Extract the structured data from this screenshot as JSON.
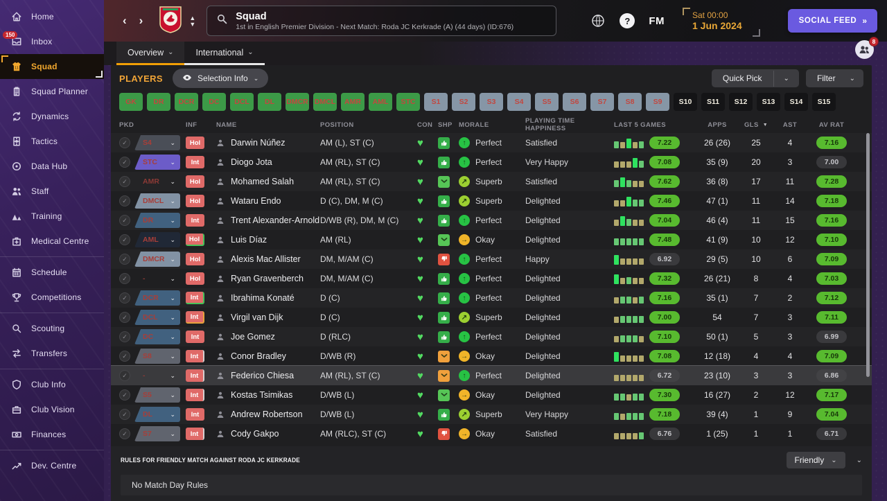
{
  "sidebar": {
    "items": [
      {
        "label": "Home",
        "icon": "home-icon"
      },
      {
        "label": "Inbox",
        "icon": "inbox-icon",
        "badge": "150"
      },
      {
        "label": "Squad",
        "icon": "jersey-icon",
        "active": true
      },
      {
        "label": "Squad Planner",
        "icon": "clipboard-icon"
      },
      {
        "label": "Dynamics",
        "icon": "dynamics-icon"
      },
      {
        "label": "Tactics",
        "icon": "tactics-icon"
      },
      {
        "label": "Data Hub",
        "icon": "data-hub-icon"
      },
      {
        "label": "Staff",
        "icon": "staff-icon"
      },
      {
        "label": "Training",
        "icon": "training-icon"
      },
      {
        "label": "Medical Centre",
        "icon": "medical-icon",
        "divider_after": true
      },
      {
        "label": "Schedule",
        "icon": "calendar-icon"
      },
      {
        "label": "Competitions",
        "icon": "trophy-icon",
        "divider_after": true
      },
      {
        "label": "Scouting",
        "icon": "scouting-icon"
      },
      {
        "label": "Transfers",
        "icon": "transfers-icon",
        "divider_after": true
      },
      {
        "label": "Club Info",
        "icon": "shield-icon"
      },
      {
        "label": "Club Vision",
        "icon": "briefcase-icon"
      },
      {
        "label": "Finances",
        "icon": "finances-icon",
        "divider_after": true
      },
      {
        "label": "Dev. Centre",
        "icon": "dev-centre-icon"
      }
    ]
  },
  "header": {
    "title": "Squad",
    "subtitle": "1st in English Premier Division - Next Match: Roda JC Kerkrade (A) (44 days) (ID:676)",
    "fm_logo": "FM",
    "help_label": "?",
    "date_line1": "Sat 00:00",
    "date_line2": "1 Jun 2024",
    "social_feed_label": "SOCIAL FEED",
    "social_feed_chevrons": "»",
    "notification_count": "8",
    "tabs": [
      {
        "label": "Overview",
        "active": true
      },
      {
        "label": "International",
        "active": false
      }
    ]
  },
  "toolbar": {
    "players_label": "PLAYERS",
    "selection_info_label": "Selection Info",
    "quick_pick_label": "Quick Pick",
    "filter_label": "Filter"
  },
  "position_filters": [
    {
      "label": "GK",
      "style": "green"
    },
    {
      "label": "DR",
      "style": "green"
    },
    {
      "label": "DCR",
      "style": "green"
    },
    {
      "label": "DC",
      "style": "green"
    },
    {
      "label": "DCL",
      "style": "green"
    },
    {
      "label": "DL",
      "style": "green"
    },
    {
      "label": "DMCR",
      "style": "green"
    },
    {
      "label": "DMCL",
      "style": "green"
    },
    {
      "label": "AMR",
      "style": "green"
    },
    {
      "label": "AML",
      "style": "green"
    },
    {
      "label": "STC",
      "style": "green"
    },
    {
      "label": "S1",
      "style": "slate"
    },
    {
      "label": "S2",
      "style": "slate"
    },
    {
      "label": "S3",
      "style": "slate"
    },
    {
      "label": "S4",
      "style": "slate"
    },
    {
      "label": "S5",
      "style": "slate"
    },
    {
      "label": "S6",
      "style": "slate"
    },
    {
      "label": "S7",
      "style": "slate"
    },
    {
      "label": "S8",
      "style": "slate"
    },
    {
      "label": "S9",
      "style": "slate"
    },
    {
      "label": "S10",
      "style": "dark"
    },
    {
      "label": "S11",
      "style": "dark"
    },
    {
      "label": "S12",
      "style": "dark"
    },
    {
      "label": "S13",
      "style": "dark"
    },
    {
      "label": "S14",
      "style": "dark"
    },
    {
      "label": "S15",
      "style": "dark"
    }
  ],
  "table": {
    "headers": {
      "pkd": "PKD",
      "inf": "INF",
      "name": "NAME",
      "position": "POSITION",
      "con": "CON",
      "shp": "SHP",
      "morale": "MORALE",
      "happiness": "PLAYING TIME HAPPINESS",
      "last5": "LAST 5 GAMES",
      "apps": "APPS",
      "gls": "GLS",
      "ast": "AST",
      "avrat": "AV RAT"
    },
    "rows": [
      {
        "pkd": "S4",
        "pkd_style": "dark",
        "inf": "Hol",
        "inf_accent": null,
        "name": "Darwin Núñez",
        "position": "AM (L), ST (C)",
        "shp": "up",
        "morale": "Perfect",
        "morale_level": "perfect",
        "happiness": "Satisfied",
        "bars": [
          "g",
          "t",
          "G",
          "t",
          "g"
        ],
        "l5": "7.22",
        "l5_pill": true,
        "apps": "26 (26)",
        "gls": "25",
        "ast": "4",
        "av": "7.16",
        "av_pill": true,
        "selected": false
      },
      {
        "pkd": "STC",
        "pkd_style": "purple",
        "inf": "Int",
        "inf_accent": null,
        "name": "Diogo Jota",
        "position": "AM (RL), ST (C)",
        "shp": "up",
        "morale": "Perfect",
        "morale_level": "perfect",
        "happiness": "Very Happy",
        "bars": [
          "t",
          "t",
          "t",
          "G",
          "g"
        ],
        "l5": "7.08",
        "l5_pill": true,
        "apps": "35 (9)",
        "gls": "20",
        "ast": "3",
        "av": "7.00",
        "av_pill": false,
        "selected": false
      },
      {
        "pkd": "AMR",
        "pkd_style": "none",
        "inf": "Hol",
        "inf_accent": null,
        "name": "Mohamed Salah",
        "position": "AM (RL), ST (C)",
        "shp": "env-green",
        "morale": "Superb",
        "morale_level": "superb",
        "happiness": "Satisfied",
        "bars": [
          "g",
          "G",
          "g",
          "t",
          "t"
        ],
        "l5": "7.62",
        "l5_pill": true,
        "apps": "36 (8)",
        "gls": "17",
        "ast": "11",
        "av": "7.28",
        "av_pill": true,
        "selected": false
      },
      {
        "pkd": "DMCL",
        "pkd_style": "slate",
        "inf": "Hol",
        "inf_accent": null,
        "name": "Wataru Endo",
        "position": "D (C), DM, M (C)",
        "shp": "up",
        "morale": "Superb",
        "morale_level": "superb",
        "happiness": "Delighted",
        "bars": [
          "t",
          "t",
          "G",
          "g",
          "g"
        ],
        "l5": "7.46",
        "l5_pill": true,
        "apps": "47 (1)",
        "gls": "11",
        "ast": "14",
        "av": "7.18",
        "av_pill": true,
        "selected": false
      },
      {
        "pkd": "DR",
        "pkd_style": "blue",
        "inf": "Int",
        "inf_accent": null,
        "name": "Trent Alexander-Arnold",
        "position": "D/WB (R), DM, M (C)",
        "shp": "up",
        "morale": "Perfect",
        "morale_level": "perfect",
        "happiness": "Delighted",
        "bars": [
          "t",
          "G",
          "g",
          "t",
          "t"
        ],
        "l5": "7.04",
        "l5_pill": true,
        "apps": "46 (4)",
        "gls": "11",
        "ast": "15",
        "av": "7.16",
        "av_pill": true,
        "selected": false
      },
      {
        "pkd": "AML",
        "pkd_style": "navy",
        "inf": "Hol",
        "inf_accent": "green",
        "name": "Luis Díaz",
        "position": "AM (RL)",
        "shp": "env-green",
        "morale": "Okay",
        "morale_level": "okay",
        "happiness": "Delighted",
        "bars": [
          "g",
          "g",
          "g",
          "g",
          "g"
        ],
        "l5": "7.48",
        "l5_pill": true,
        "apps": "41 (9)",
        "gls": "10",
        "ast": "12",
        "av": "7.10",
        "av_pill": true,
        "selected": false
      },
      {
        "pkd": "DMCR",
        "pkd_style": "slate",
        "inf": "Hol",
        "inf_accent": null,
        "name": "Alexis Mac Allister",
        "position": "DM, M/AM (C)",
        "shp": "down",
        "morale": "Perfect",
        "morale_level": "perfect",
        "happiness": "Happy",
        "bars": [
          "G",
          "t",
          "t",
          "t",
          "t"
        ],
        "l5": "6.92",
        "l5_pill": false,
        "apps": "29 (5)",
        "gls": "10",
        "ast": "6",
        "av": "7.09",
        "av_pill": true,
        "selected": false
      },
      {
        "pkd": "-",
        "pkd_style": "none",
        "inf": "Hol",
        "inf_accent": null,
        "name": "Ryan Gravenberch",
        "position": "DM, M/AM (C)",
        "shp": "up",
        "morale": "Perfect",
        "morale_level": "perfect",
        "happiness": "Delighted",
        "bars": [
          "G",
          "t",
          "g",
          "t",
          "t"
        ],
        "l5": "7.32",
        "l5_pill": true,
        "apps": "26 (21)",
        "gls": "8",
        "ast": "4",
        "av": "7.03",
        "av_pill": true,
        "selected": false
      },
      {
        "pkd": "DCR",
        "pkd_style": "blue",
        "inf": "Int",
        "inf_accent": "green",
        "name": "Ibrahima Konaté",
        "position": "D (C)",
        "shp": "up",
        "morale": "Perfect",
        "morale_level": "perfect",
        "happiness": "Delighted",
        "bars": [
          "t",
          "g",
          "g",
          "t",
          "g"
        ],
        "l5": "7.16",
        "l5_pill": true,
        "apps": "35 (1)",
        "gls": "7",
        "ast": "2",
        "av": "7.12",
        "av_pill": true,
        "selected": false
      },
      {
        "pkd": "DCL",
        "pkd_style": "blue",
        "inf": "Int",
        "inf_accent": "orange",
        "name": "Virgil van Dijk",
        "position": "D (C)",
        "shp": "up",
        "morale": "Superb",
        "morale_level": "superb",
        "happiness": "Delighted",
        "bars": [
          "t",
          "g",
          "g",
          "g",
          "g"
        ],
        "l5": "7.00",
        "l5_pill": true,
        "apps": "54",
        "gls": "7",
        "ast": "3",
        "av": "7.11",
        "av_pill": true,
        "selected": false
      },
      {
        "pkd": "DC",
        "pkd_style": "blue",
        "inf": "Int",
        "inf_accent": null,
        "name": "Joe Gomez",
        "position": "D (RLC)",
        "shp": "up",
        "morale": "Perfect",
        "morale_level": "perfect",
        "happiness": "Delighted",
        "bars": [
          "t",
          "g",
          "g",
          "g",
          "t"
        ],
        "l5": "7.10",
        "l5_pill": true,
        "apps": "50 (1)",
        "gls": "5",
        "ast": "3",
        "av": "6.99",
        "av_pill": false,
        "selected": false
      },
      {
        "pkd": "S8",
        "pkd_style": "gray",
        "inf": "Int",
        "inf_accent": "light",
        "name": "Conor Bradley",
        "position": "D/WB (R)",
        "shp": "env-orange",
        "morale": "Okay",
        "morale_level": "okay",
        "happiness": "Delighted",
        "bars": [
          "G",
          "t",
          "t",
          "t",
          "t"
        ],
        "l5": "7.08",
        "l5_pill": true,
        "apps": "12 (18)",
        "gls": "4",
        "ast": "4",
        "av": "7.09",
        "av_pill": true,
        "selected": false
      },
      {
        "pkd": "-",
        "pkd_style": "none",
        "inf": "Int",
        "inf_accent": "light",
        "name": "Federico Chiesa",
        "position": "AM (RL), ST (C)",
        "shp": "env-orange",
        "morale": "Perfect",
        "morale_level": "perfect",
        "happiness": "Delighted",
        "bars": [
          "t",
          "t",
          "t",
          "t",
          "t"
        ],
        "l5": "6.72",
        "l5_pill": false,
        "apps": "23 (10)",
        "gls": "3",
        "ast": "3",
        "av": "6.86",
        "av_pill": false,
        "selected": true
      },
      {
        "pkd": "S5",
        "pkd_style": "gray",
        "inf": "Int",
        "inf_accent": "light",
        "name": "Kostas Tsimikas",
        "position": "D/WB (L)",
        "shp": "env-green",
        "morale": "Okay",
        "morale_level": "okay",
        "happiness": "Delighted",
        "bars": [
          "g",
          "g",
          "t",
          "g",
          "g"
        ],
        "l5": "7.30",
        "l5_pill": true,
        "apps": "16 (27)",
        "gls": "2",
        "ast": "12",
        "av": "7.17",
        "av_pill": true,
        "selected": false
      },
      {
        "pkd": "DL",
        "pkd_style": "blue",
        "inf": "Int",
        "inf_accent": null,
        "name": "Andrew Robertson",
        "position": "D/WB (L)",
        "shp": "up",
        "morale": "Superb",
        "morale_level": "superb",
        "happiness": "Very Happy",
        "bars": [
          "g",
          "t",
          "g",
          "g",
          "g"
        ],
        "l5": "7.18",
        "l5_pill": true,
        "apps": "39 (4)",
        "gls": "1",
        "ast": "9",
        "av": "7.04",
        "av_pill": true,
        "selected": false
      },
      {
        "pkd": "S7",
        "pkd_style": "gray",
        "inf": "Int",
        "inf_accent": "light",
        "name": "Cody Gakpo",
        "position": "AM (RLC), ST (C)",
        "shp": "down",
        "morale": "Okay",
        "morale_level": "okay",
        "happiness": "Satisfied",
        "bars": [
          "t",
          "t",
          "t",
          "t",
          "g"
        ],
        "l5": "6.76",
        "l5_pill": false,
        "apps": "1 (25)",
        "gls": "1",
        "ast": "1",
        "av": "6.71",
        "av_pill": false,
        "selected": false
      }
    ]
  },
  "footer": {
    "rules_title": "RULES FOR FRIENDLY MATCH AGAINST RODA JC KERKRADE",
    "no_rules_label": "No Match Day Rules",
    "match_type_label": "Friendly"
  },
  "colors": {
    "accent_orange": "#f29f05",
    "rating_pill_green": "#58ba2f",
    "sidebar_active_gold": "#f2a82e",
    "social_feed_purple": "#6a5ae0",
    "inf_badge_red": "#e06a68"
  }
}
